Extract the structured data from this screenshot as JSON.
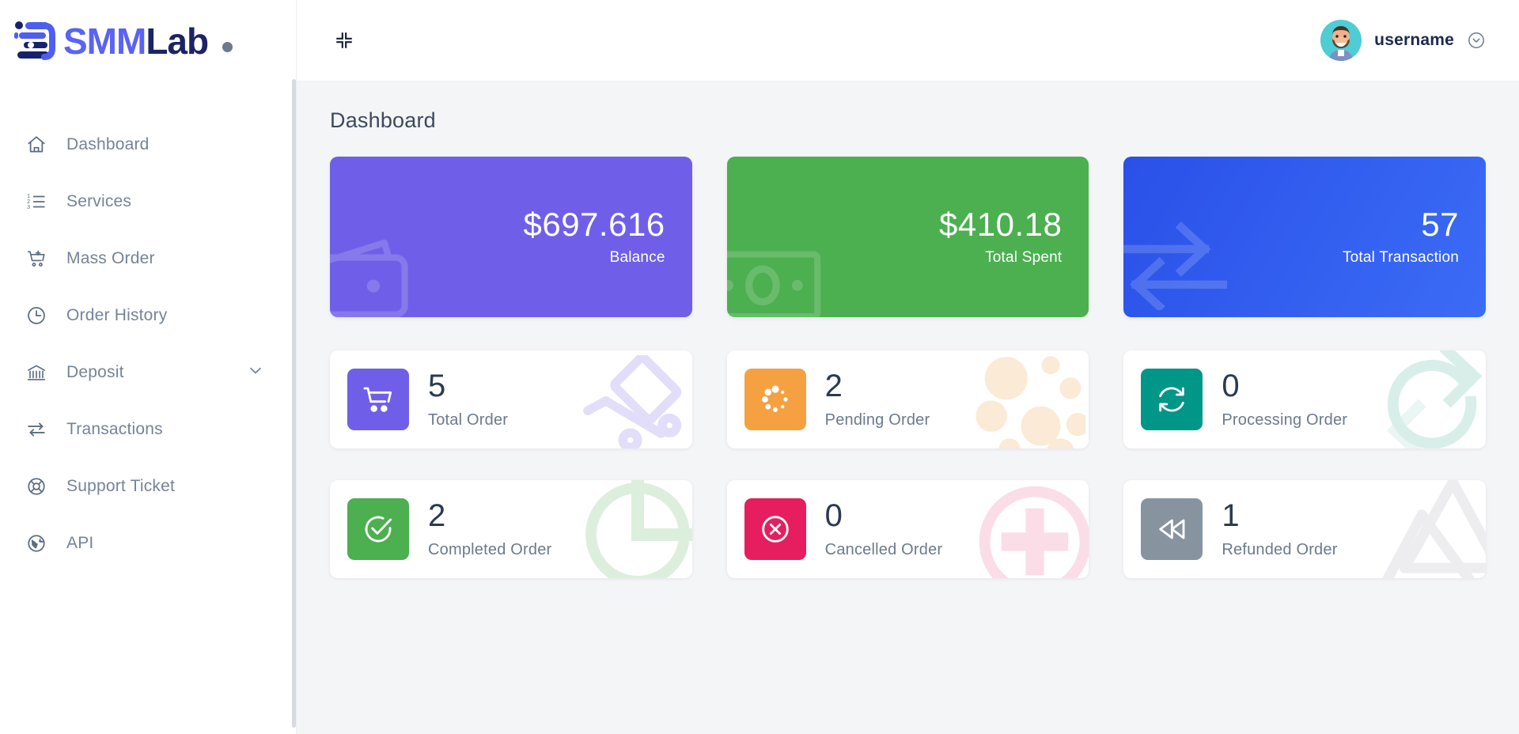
{
  "brand": {
    "name_part1": "SMM",
    "name_part2": "Lab",
    "logo_icon": "smmlab-logo-icon",
    "dot_icon": "brand-dot-icon"
  },
  "sidebar": {
    "items": [
      {
        "label": "Dashboard",
        "icon": "home-icon",
        "has_chevron": false
      },
      {
        "label": "Services",
        "icon": "list-ordered-icon",
        "has_chevron": false
      },
      {
        "label": "Mass Order",
        "icon": "cart-plus-icon",
        "has_chevron": false
      },
      {
        "label": "Order History",
        "icon": "clock-icon",
        "has_chevron": false
      },
      {
        "label": "Deposit",
        "icon": "bank-icon",
        "has_chevron": true
      },
      {
        "label": "Transactions",
        "icon": "exchange-icon",
        "has_chevron": false
      },
      {
        "label": "Support Ticket",
        "icon": "lifebuoy-icon",
        "has_chevron": false
      },
      {
        "label": "API",
        "icon": "globe-icon",
        "has_chevron": false
      }
    ],
    "scrollbar": "sidebar-scrollbar"
  },
  "topbar": {
    "collapse_icon": "compress-icon",
    "username": "username",
    "avatar_icon": "user-avatar",
    "caret_icon": "chevron-down-circle-icon"
  },
  "page": {
    "title": "Dashboard"
  },
  "summary_cards": [
    {
      "value": "$697.616",
      "label": "Balance",
      "theme": "purple",
      "watermark": "wallet-icon"
    },
    {
      "value": "$410.18",
      "label": "Total Spent",
      "theme": "green",
      "watermark": "money-bill-icon"
    },
    {
      "value": "57",
      "label": "Total Transaction",
      "theme": "blue",
      "watermark": "exchange-arrows-icon"
    }
  ],
  "order_cards": [
    {
      "value": "5",
      "label": "Total Order",
      "theme": "purple",
      "icon": "cart-icon",
      "watermark": "hand-truck-icon"
    },
    {
      "value": "2",
      "label": "Pending Order",
      "theme": "orange",
      "icon": "spinner-icon",
      "watermark": "dots-circle-icon"
    },
    {
      "value": "0",
      "label": "Processing Order",
      "theme": "teal",
      "icon": "sync-icon",
      "watermark": "sync-arrows-icon"
    },
    {
      "value": "2",
      "label": "Completed Order",
      "theme": "green",
      "icon": "check-circle-icon",
      "watermark": "pie-chart-icon"
    },
    {
      "value": "0",
      "label": "Cancelled Order",
      "theme": "pink",
      "icon": "times-circle-icon",
      "watermark": "plus-circle-icon"
    },
    {
      "value": "1",
      "label": "Refunded Order",
      "theme": "gray",
      "icon": "rewind-icon",
      "watermark": "triangles-icon"
    }
  ],
  "colors": {
    "purple": "#6F5FE8",
    "green": "#4CAF50",
    "blue": "#2F5BF0",
    "orange": "#F5A142",
    "teal": "#009688",
    "pink": "#E61E5F",
    "gray": "#8794A0",
    "background": "#F4F5F7",
    "text_muted": "#6B7A90",
    "text_dark": "#2B3A52"
  }
}
